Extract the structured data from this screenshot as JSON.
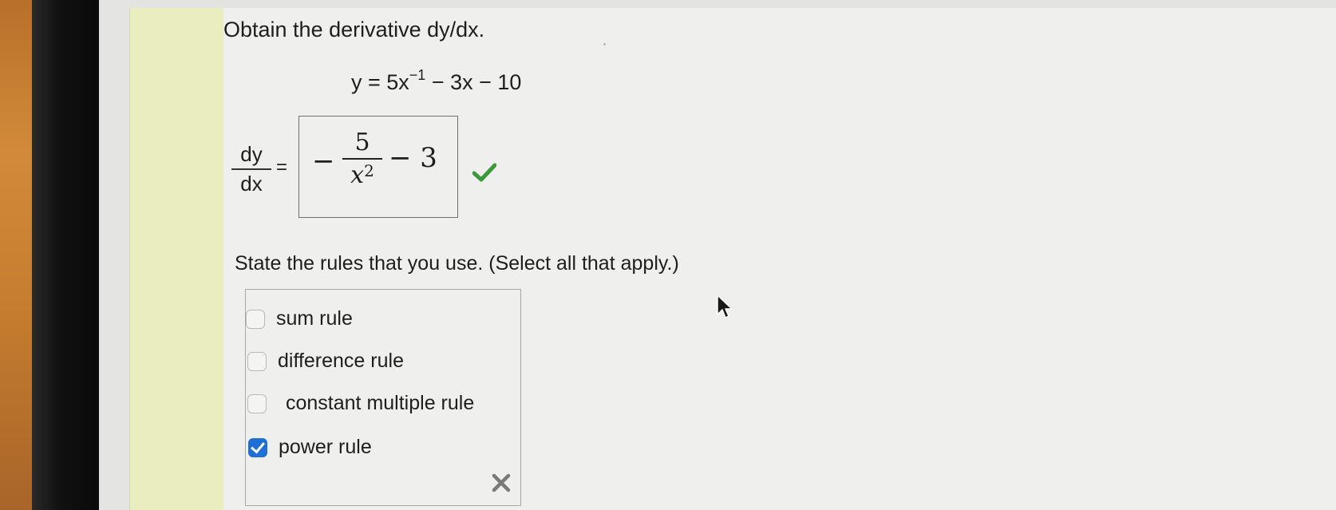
{
  "question": {
    "prompt": "Obtain the derivative dy/dx.",
    "equation_lhs": "y = 5x",
    "equation_exp": "−1",
    "equation_rhs": " − 3x − 10"
  },
  "derivative": {
    "lhs_numerator": "dy",
    "lhs_denominator": "dx",
    "equals": "=",
    "answer": {
      "leading_sign": "−",
      "numerator": "5",
      "denominator_base": "x",
      "denominator_exp": "2",
      "tail": "− 3"
    },
    "status": "correct",
    "status_icon": "checkmark-icon",
    "status_color": "#3a9a3a"
  },
  "rules": {
    "instruction": "State the rules that you use. (Select all that apply.)",
    "options": [
      {
        "label": "sum rule",
        "checked": false
      },
      {
        "label": "difference rule",
        "checked": false
      },
      {
        "label": "constant multiple rule",
        "checked": false
      },
      {
        "label": "power rule",
        "checked": true
      }
    ],
    "status": "incorrect",
    "status_icon": "x-mark-icon",
    "status_color": "#7a7a7a",
    "checkbox_color": "#1f6fd6"
  }
}
